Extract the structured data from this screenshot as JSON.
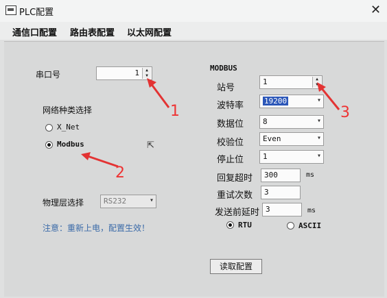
{
  "window": {
    "title": "PLC配置",
    "close_glyph": "✕"
  },
  "menu": [
    "通信口配置",
    "路由表配置",
    "以太网配置"
  ],
  "left": {
    "port_label": "串口号",
    "port_value": "1",
    "network_type_label": "网络种类选择",
    "options": [
      "X_Net",
      "Modbus"
    ],
    "selected_option": "Modbus",
    "physical_label": "物理层选择",
    "physical_value": "RS232",
    "note": "注意：重新上电，配置生效！"
  },
  "modbus": {
    "title": "MODBUS",
    "station_label": "站号",
    "station_value": "1",
    "baud_label": "波特率",
    "baud_value": "19200",
    "databits_label": "数据位",
    "databits_value": "8",
    "parity_label": "校验位",
    "parity_value": "Even",
    "stopbits_label": "停止位",
    "stopbits_value": "1",
    "timeout_label": "回复超时",
    "timeout_value": "300",
    "timeout_unit": "ms",
    "retry_label": "重试次数",
    "retry_value": "3",
    "delay_label": "发送前延时",
    "delay_value": "3",
    "delay_unit": "ms",
    "modes": [
      "RTU",
      "ASCII"
    ],
    "selected_mode": "RTU"
  },
  "read_button": "读取配置",
  "annotations": [
    "1",
    "2",
    "3"
  ],
  "colors": {
    "arrow": "#e33333",
    "note": "#3a6aa8",
    "selection": "#2b56b8"
  }
}
